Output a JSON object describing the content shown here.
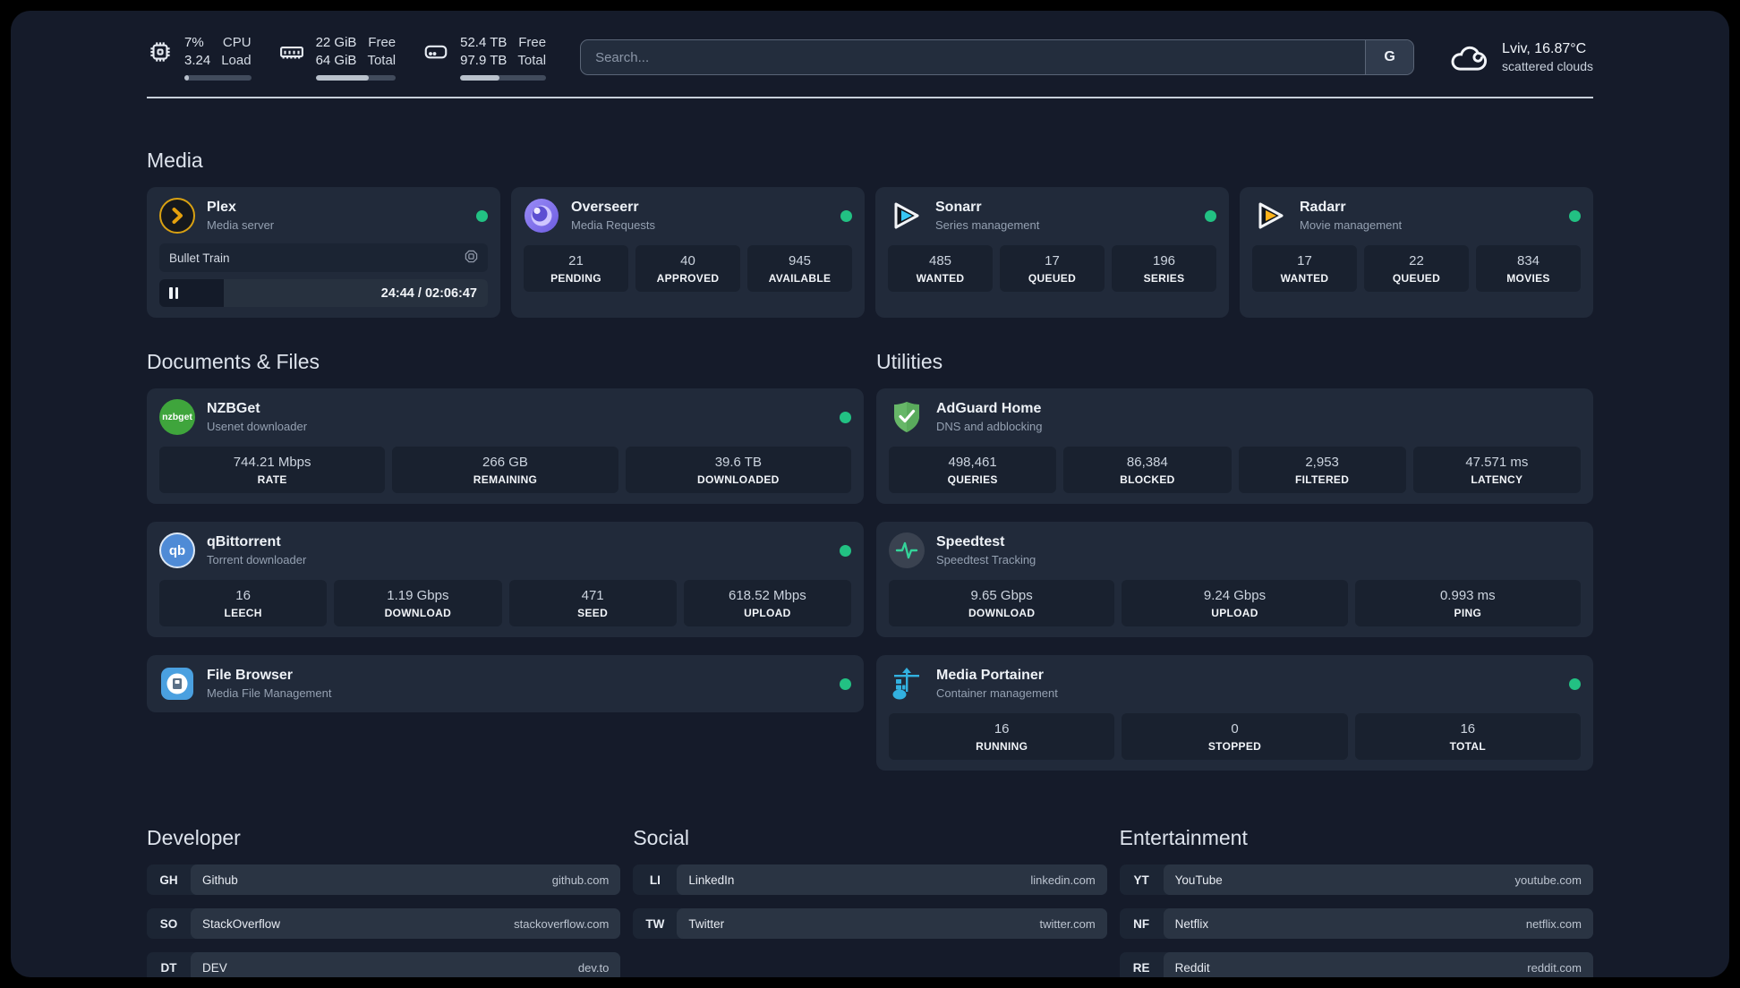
{
  "colors": {
    "status_online": "#22c183",
    "accent_plex": "#e5a00d",
    "accent_sonarr": "#38c6f4",
    "accent_radarr": "#ffb31a"
  },
  "header": {
    "stats": [
      {
        "icon": "cpu-icon",
        "value_top": "7%",
        "value_bottom": "3.24",
        "label_top": "CPU",
        "label_bottom": "Load",
        "progress_pct": 7
      },
      {
        "icon": "ram-icon",
        "value_top": "22 GiB",
        "value_bottom": "64 GiB",
        "label_top": "Free",
        "label_bottom": "Total",
        "progress_pct": 66
      },
      {
        "icon": "disk-icon",
        "value_top": "52.4 TB",
        "value_bottom": "97.9 TB",
        "label_top": "Free",
        "label_bottom": "Total",
        "progress_pct": 46
      }
    ],
    "search": {
      "placeholder": "Search...",
      "engine_button": "G"
    },
    "weather": {
      "line1": "Lviv, 16.87°C",
      "line2": "scattered clouds"
    }
  },
  "sections": {
    "media": {
      "title": "Media",
      "apps": [
        {
          "name": "Plex",
          "description": "Media server",
          "status": "online",
          "player": {
            "track": "Bullet Train",
            "elapsed": "24:44",
            "duration": "02:06:47",
            "time_display": "24:44 / 02:06:47",
            "progress_pct": 19.5
          }
        },
        {
          "name": "Overseerr",
          "description": "Media Requests",
          "status": "online",
          "stats": [
            {
              "value": "21",
              "label": "PENDING"
            },
            {
              "value": "40",
              "label": "APPROVED"
            },
            {
              "value": "945",
              "label": "AVAILABLE"
            }
          ]
        },
        {
          "name": "Sonarr",
          "description": "Series management",
          "status": "online",
          "stats": [
            {
              "value": "485",
              "label": "WANTED"
            },
            {
              "value": "17",
              "label": "QUEUED"
            },
            {
              "value": "196",
              "label": "SERIES"
            }
          ]
        },
        {
          "name": "Radarr",
          "description": "Movie management",
          "status": "online",
          "stats": [
            {
              "value": "17",
              "label": "WANTED"
            },
            {
              "value": "22",
              "label": "QUEUED"
            },
            {
              "value": "834",
              "label": "MOVIES"
            }
          ]
        }
      ]
    },
    "documents": {
      "title": "Documents & Files",
      "apps": [
        {
          "name": "NZBGet",
          "description": "Usenet downloader",
          "status": "online",
          "stats": [
            {
              "value": "744.21 Mbps",
              "label": "RATE"
            },
            {
              "value": "266 GB",
              "label": "REMAINING"
            },
            {
              "value": "39.6 TB",
              "label": "DOWNLOADED"
            }
          ]
        },
        {
          "name": "qBittorrent",
          "description": "Torrent downloader",
          "status": "online",
          "stats": [
            {
              "value": "16",
              "label": "LEECH"
            },
            {
              "value": "1.19 Gbps",
              "label": "DOWNLOAD"
            },
            {
              "value": "471",
              "label": "SEED"
            },
            {
              "value": "618.52 Mbps",
              "label": "UPLOAD"
            }
          ]
        },
        {
          "name": "File Browser",
          "description": "Media File Management",
          "status": "online",
          "stats": []
        }
      ]
    },
    "utilities": {
      "title": "Utilities",
      "apps": [
        {
          "name": "AdGuard Home",
          "description": "DNS and adblocking",
          "stats": [
            {
              "value": "498,461",
              "label": "QUERIES"
            },
            {
              "value": "86,384",
              "label": "BLOCKED"
            },
            {
              "value": "2,953",
              "label": "FILTERED"
            },
            {
              "value": "47.571 ms",
              "label": "LATENCY"
            }
          ]
        },
        {
          "name": "Speedtest",
          "description": "Speedtest Tracking",
          "stats": [
            {
              "value": "9.65 Gbps",
              "label": "DOWNLOAD"
            },
            {
              "value": "9.24 Gbps",
              "label": "UPLOAD"
            },
            {
              "value": "0.993 ms",
              "label": "PING"
            }
          ]
        },
        {
          "name": "Media Portainer",
          "description": "Container management",
          "status": "online",
          "stats": [
            {
              "value": "16",
              "label": "RUNNING"
            },
            {
              "value": "0",
              "label": "STOPPED"
            },
            {
              "value": "16",
              "label": "TOTAL"
            }
          ]
        }
      ]
    },
    "links": {
      "developer": {
        "title": "Developer",
        "items": [
          {
            "abbr": "GH",
            "name": "Github",
            "url": "github.com"
          },
          {
            "abbr": "SO",
            "name": "StackOverflow",
            "url": "stackoverflow.com"
          },
          {
            "abbr": "DT",
            "name": "DEV",
            "url": "dev.to"
          }
        ]
      },
      "social": {
        "title": "Social",
        "items": [
          {
            "abbr": "LI",
            "name": "LinkedIn",
            "url": "linkedin.com"
          },
          {
            "abbr": "TW",
            "name": "Twitter",
            "url": "twitter.com"
          }
        ]
      },
      "entertainment": {
        "title": "Entertainment",
        "items": [
          {
            "abbr": "YT",
            "name": "YouTube",
            "url": "youtube.com"
          },
          {
            "abbr": "NF",
            "name": "Netflix",
            "url": "netflix.com"
          },
          {
            "abbr": "RE",
            "name": "Reddit",
            "url": "reddit.com"
          }
        ]
      }
    }
  }
}
